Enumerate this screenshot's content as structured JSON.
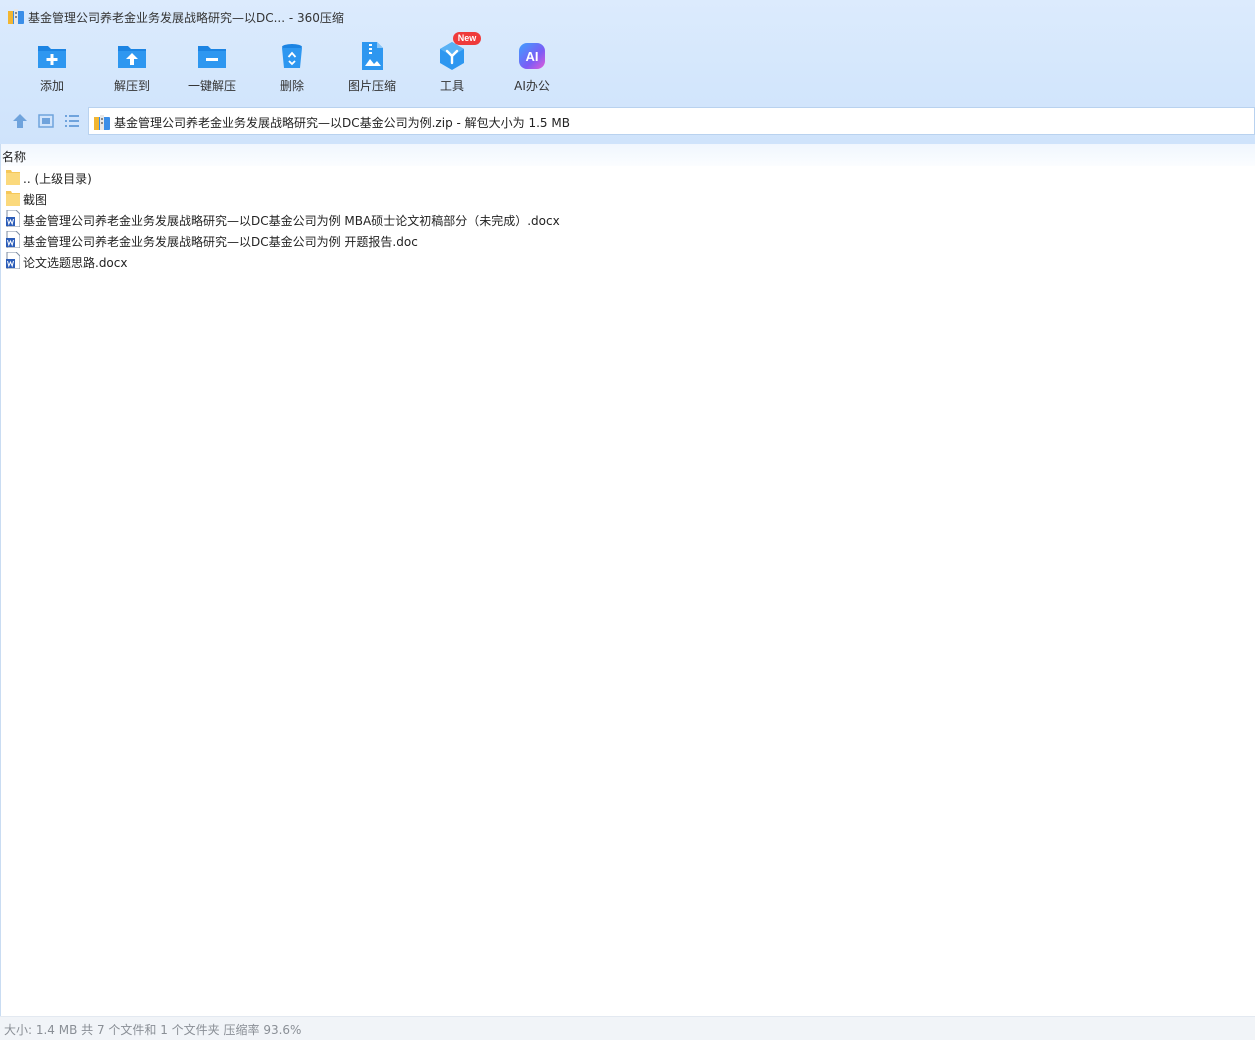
{
  "window": {
    "title": "基金管理公司养老金业务发展战略研究—以DC... - 360压缩"
  },
  "toolbar": {
    "items": [
      {
        "label": "添加",
        "icon": "add-folder-icon"
      },
      {
        "label": "解压到",
        "icon": "extract-to-icon"
      },
      {
        "label": "一键解压",
        "icon": "one-click-extract-icon"
      },
      {
        "label": "删除",
        "icon": "trash-icon"
      },
      {
        "label": "图片压缩",
        "icon": "image-compress-icon"
      },
      {
        "label": "工具",
        "icon": "tools-icon",
        "badge": "New"
      },
      {
        "label": "AI办公",
        "icon": "ai-office-icon",
        "icon_text": "AI"
      }
    ]
  },
  "address": {
    "path": "基金管理公司养老金业务发展战略研究—以DC基金公司为例.zip - 解包大小为 1.5 MB"
  },
  "list": {
    "column_name": "名称",
    "rows": [
      {
        "name": ".. (上级目录)",
        "type": "folder"
      },
      {
        "name": "截图",
        "type": "folder"
      },
      {
        "name": "基金管理公司养老金业务发展战略研究—以DC基金公司为例 MBA硕士论文初稿部分（未完成）.docx",
        "type": "word"
      },
      {
        "name": "基金管理公司养老金业务发展战略研究—以DC基金公司为例 开题报告.doc",
        "type": "word"
      },
      {
        "name": "论文选题思路.docx",
        "type": "word"
      }
    ]
  },
  "status": {
    "text": "大小: 1.4 MB 共 7 个文件和 1 个文件夹 压缩率 93.6%"
  },
  "colors": {
    "accent": "#1e8ae6",
    "toolbar_bg": "#d6e8fc",
    "badge": "#ef3b3b",
    "folder": "#f9d36b"
  }
}
